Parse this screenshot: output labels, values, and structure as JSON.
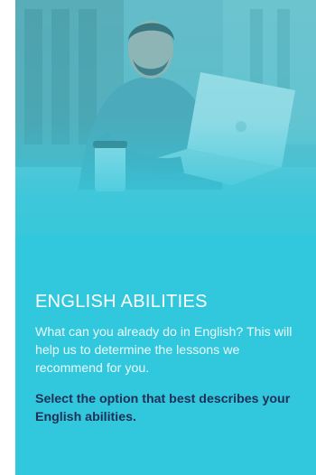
{
  "hero": {
    "image": "man-with-laptop-photo"
  },
  "section": {
    "title": "ENGLISH ABILITIES",
    "description": "What can you already do in English? This will help us to determine the lessons we recommend for you.",
    "instruction": "Select the option that best describes your English abilities."
  },
  "colors": {
    "accent": "#31c7dc",
    "instruction_text": "#1f2f57"
  }
}
